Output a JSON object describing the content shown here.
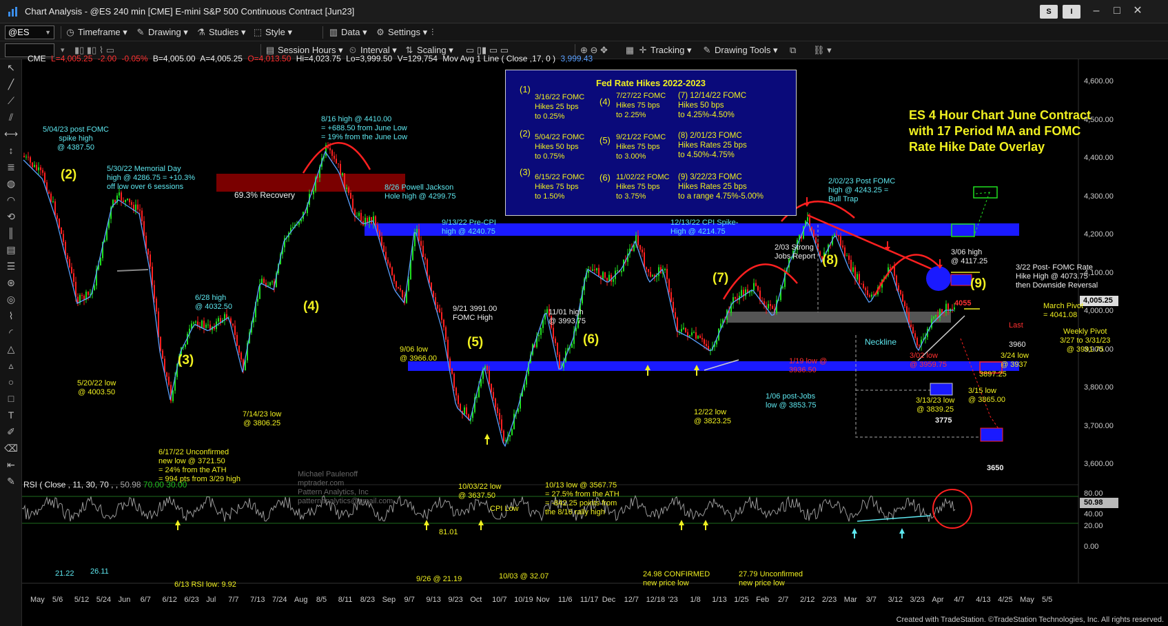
{
  "window": {
    "title": "Chart Analysis - @ES 240 min [CME] E-mini S&P 500 Continuous Contract [Jun23]",
    "btn_s": "S",
    "btn_i": "I"
  },
  "toolbar1": {
    "symbol": "@ES",
    "timeframe": "Timeframe",
    "drawing": "Drawing",
    "studies": "Studies",
    "style": "Style",
    "data": "Data",
    "settings": "Settings"
  },
  "toolbar2": {
    "session_hours": "Session Hours",
    "interval": "Interval",
    "scaling": "Scaling",
    "tracking": "Tracking",
    "drawing_tools": "Drawing Tools"
  },
  "header": {
    "exchange": "CME",
    "last": "L=4,005.25",
    "chg": "-2.00",
    "pct": "-0.05%",
    "bid": "B=4,005.00",
    "ask": "A=4,005.25",
    "open": "O=4,013.50",
    "hi": "Hi=4,023.75",
    "lo": "Lo=3,999.50",
    "vol": "V=129,754",
    "ma": "Mov Avg 1 Line ( Close ,17, 0 )",
    "ma_val": "3,999.43"
  },
  "price_axis": [
    "4,600.00",
    "4,500.00",
    "4,400.00",
    "4,300.00",
    "4,200.00",
    "4,100.00",
    "4,000.00",
    "3,900.00",
    "3,800.00",
    "3,700.00",
    "3,600.00"
  ],
  "last_price_tag": "4,005.25",
  "rsi": {
    "header": "RSI ( Close , 11, 30, 70 , ,",
    "val": "50.98",
    "ob": "70.00",
    "os": "30.00",
    "axis": [
      "80.00",
      "40.00",
      "20.00",
      "0.00"
    ],
    "tag": "50.98"
  },
  "time_axis": [
    "May",
    "5/6",
    "5/12",
    "5/24",
    "Jun",
    "6/7",
    "6/12",
    "6/23",
    "Jul",
    "7/7",
    "7/13",
    "7/24",
    "Aug",
    "8/5",
    "8/11",
    "8/23",
    "Sep",
    "9/7",
    "9/13",
    "9/23",
    "Oct",
    "10/7",
    "10/19",
    "Nov",
    "11/6",
    "11/17",
    "Dec",
    "12/7",
    "12/18",
    "'23",
    "1/8",
    "1/13",
    "1/25",
    "Feb",
    "2/7",
    "2/12",
    "2/23",
    "Mar",
    "3/7",
    "3/12",
    "3/23",
    "Apr",
    "4/7",
    "4/13",
    "4/25",
    "May",
    "5/5"
  ],
  "fed_box": {
    "title": "Fed Rate Hikes 2022-2023",
    "items": [
      {
        "num": "(1)",
        "text": "3/16/22 FOMC\nHikes 25 bps\nto 0.25%"
      },
      {
        "num": "(2)",
        "text": "5/04/22 FOMC\nHikes 50 bps\nto 0.75%"
      },
      {
        "num": "(3)",
        "text": "6/15/22 FOMC\nHikes 75 bps\nto 1.50%"
      },
      {
        "num": "(4)",
        "text": "7/27/22 FOMC\nHikes 75 bps\nto 2.25%"
      },
      {
        "num": "(5)",
        "text": "9/21/22 FOMC\nHikes 75 bps\nto 3.00%"
      },
      {
        "num": "(6)",
        "text": "11/02/22 FOMC\nHikes 75 bps\nto 3.75%"
      },
      {
        "num": "",
        "text": "(7) 12/14/22 FOMC\nHikes 50 bps\nto 4.25%-4.50%"
      },
      {
        "num": "",
        "text": "(8) 2/01/23 FOMC\nHikes Rates 25 bps\nto 4.50%-4.75%"
      },
      {
        "num": "",
        "text": "(9) 3/22/23 FOMC\nHikes Rates 25 bps\nto a range 4.75%-5.00%"
      }
    ]
  },
  "headline": "ES 4 Hour Chart June Contract\nwith 17 Period MA and FOMC\nRate Hike Date Overlay",
  "annotations": {
    "a1": "5/04/23 post FOMC\nspike high\n@ 4387.50",
    "a2": "5/30/22 Memorial Day\nhigh @ 4286.75 = +10.3%\noff low over 6 sessions",
    "a3": "8/16 high @ 4410.00\n= +688.50 from June Low\n= 19% from the June Low",
    "a4": "8/26 Powell Jackson\nHole high @ 4299.75",
    "a5": "9/13/22 Pre-CPI\nhigh @ 4240.75",
    "a6": "12/13/22 CPI Spike-\nHigh @ 4214.75",
    "a7": "2/02/23 Post FOMC\nhigh @ 4243.25 =\nBull Trap",
    "a8": "6/28 high\n@ 4032.50",
    "a9": "9/21 3991.00\nFOMC High",
    "a10": "11/01 high\n@ 3993.75",
    "a11": "5/20/22 low\n@ 4003.50",
    "a12": "7/14/23 low\n@ 3806.25",
    "a13": "9/06 low\n@ 3966.00",
    "a14": "6/17/22 Unconfirmed\nnew low @ 3721.50\n= 24% from the ATH\n= 994 pts from 3/29 high",
    "a15": "10/03/22 low\n@ 3637.50",
    "a16": "CPI Low",
    "a17": "10/13 low @ 3567.75\n= 27.5% from the ATH\n= -842.25 points from\nthe 8/16 rally high",
    "a18": "12/22 low\n@ 3823.25",
    "a19": "1/06 post-Jobs\nlow @ 3853.75",
    "a20": "1/19 low @\n3936.50",
    "a21": "2/03 Strong\nJobs Report",
    "a22": "Neckline",
    "a23": "3/06 high\n@ 4117.25",
    "a24": "3/22 Post- FOMC Rate\nHike High @ 4073.75\nthen Downside Reversal",
    "a25": "March Pivot\n= 4041.08",
    "a26": "Weekly Pivot\n3/27 to 3/31/23\n@ 3991.75",
    "a27": "Last",
    "a28": "3960",
    "a29": "3/24 low\n@ 3937",
    "a30": "3897.25",
    "a31": "3/02 low\n@ 3959.75",
    "a32": "3/13/23 low\n@ 3839.25",
    "a33": "3/15 low\n@ 3865.00",
    "a34": "69.3% Recovery",
    "a35": "4055",
    "a36": "3775",
    "a37": "3650",
    "a38": "Michael Paulenoff\nmptrader.com\nPattern Analytics, Inc\npatternanalytics@gmail.com",
    "rsi1": "21.22",
    "rsi2": "26.11",
    "rsi3": "6/13 RSI low: 9.92",
    "rsi4": "81.01",
    "rsi5": "9/26 @ 21.19",
    "rsi6": "10/03 @ 32.07",
    "rsi7": "24.98 CONFIRMED\nnew price low",
    "rsi8": "27.79 Unconfirmed\nnew price low"
  },
  "waves": [
    "(2)",
    "(3)",
    "(4)",
    "(5)",
    "(6)",
    "(7)",
    "(8)",
    "(9)"
  ],
  "footer": "Created with TradeStation. ©TradeStation Technologies, Inc. All rights reserved.",
  "colors": {
    "bg": "#000000",
    "cyan": "#5ee8f0",
    "yellow": "#f0f020",
    "red": "#ff3030",
    "blue_band": "#1a1aff",
    "up_candle": "#20e020",
    "down_candle": "#ff2020"
  }
}
